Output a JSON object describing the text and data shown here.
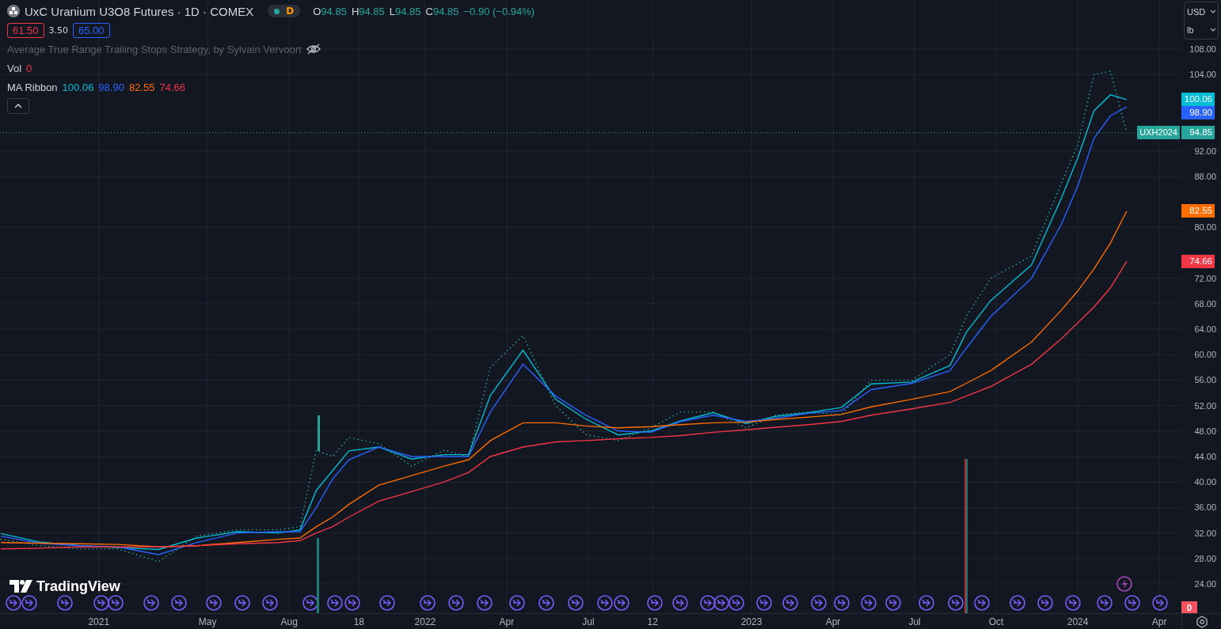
{
  "header": {
    "symbol_title": "UxC Uranium U3O8 Futures · 1D · COMEX",
    "market_status": {
      "open": true,
      "letter": "D"
    },
    "ohlc": [
      {
        "label": "O",
        "value": "94.85"
      },
      {
        "label": "H",
        "value": "94.85"
      },
      {
        "label": "L",
        "value": "94.85"
      },
      {
        "label": "C",
        "value": "94.85"
      }
    ],
    "change": "−0.90 (−0.94%)"
  },
  "strategy": {
    "inputs": [
      {
        "text": "61.50",
        "kind": "box",
        "color": "#f23645"
      },
      {
        "text": "3.50",
        "kind": "plain"
      },
      {
        "text": "65.00",
        "kind": "box",
        "color": "#2962ff"
      }
    ],
    "name": "Average True Range Trailing Stops Strategy, by Sylvain Vervoort",
    "hidden": true
  },
  "volume": {
    "label": "Vol",
    "value": "0"
  },
  "ma_ribbon": {
    "label": "MA Ribbon",
    "values": [
      {
        "text": "100.06",
        "color": "#00bcd4"
      },
      {
        "text": "98.90",
        "color": "#2962ff"
      },
      {
        "text": "82.55",
        "color": "#ff6d00"
      },
      {
        "text": "74.66",
        "color": "#f23645"
      }
    ]
  },
  "legend_toggle": {
    "expanded": true
  },
  "price_scale": {
    "currency": "USD",
    "unit": "lb",
    "last_labels": [
      {
        "text": "100.06"
      },
      {
        "text": "98.90"
      },
      {
        "text": "94.85"
      },
      {
        "text": "82.55"
      },
      {
        "text": "74.66"
      }
    ],
    "volume_label": {
      "text": "0",
      "color": "#f7525f"
    }
  },
  "branding": "TradingView",
  "chart_data": {
    "type": "line",
    "x": [
      "2020-09-13",
      "2020-10-25",
      "2020-12-10",
      "2021-01-22",
      "2021-03-07",
      "2021-04-19",
      "2021-06-04",
      "2021-07-19",
      "2021-08-13",
      "2021-09-01",
      "2021-09-19",
      "2021-10-07",
      "2021-11-10",
      "2021-12-16",
      "2022-01-22",
      "2022-02-19",
      "2022-03-13",
      "2022-04-19",
      "2022-05-25",
      "2022-06-28",
      "2022-08-04",
      "2022-09-10",
      "2022-10-13",
      "2022-11-19",
      "2022-12-25",
      "2023-01-28",
      "2023-03-04",
      "2023-04-10",
      "2023-05-13",
      "2023-06-28",
      "2023-08-10",
      "2023-08-28",
      "2023-09-25",
      "2023-11-10",
      "2023-12-13",
      "2024-01-01",
      "2024-01-19",
      "2024-02-07",
      "2024-02-25"
    ],
    "xlim": [
      "2020-09-12",
      "2024-06-09"
    ],
    "ylim": [
      19.4,
      115.7
    ],
    "grid": true,
    "ref_lines": [
      {
        "axis": "y",
        "value": 94.85,
        "color": "#26a69a"
      }
    ],
    "xticks": [
      {
        "value": "2021-01-01",
        "label": "2021"
      },
      {
        "value": "2021-05-01",
        "label": "May"
      },
      {
        "value": "2021-08-01",
        "label": "Aug"
      },
      {
        "value": "2021-10-18",
        "label": "18"
      },
      {
        "value": "2022-01-01",
        "label": "2022"
      },
      {
        "value": "2022-04-01",
        "label": "Apr"
      },
      {
        "value": "2022-07-01",
        "label": "Jul"
      },
      {
        "value": "2022-09-12",
        "label": "12"
      },
      {
        "value": "2023-01-01",
        "label": "2023"
      },
      {
        "value": "2023-04-01",
        "label": "Apr"
      },
      {
        "value": "2023-07-01",
        "label": "Jul"
      },
      {
        "value": "2023-10-01",
        "label": "Oct"
      },
      {
        "value": "2024-01-01",
        "label": "2024"
      },
      {
        "value": "2024-04-01",
        "label": "Apr"
      }
    ],
    "yticks": [
      {
        "value": 24,
        "label": "24.00"
      },
      {
        "value": 28,
        "label": "28.00"
      },
      {
        "value": 32,
        "label": "32.00"
      },
      {
        "value": 36,
        "label": "36.00"
      },
      {
        "value": 40,
        "label": "40.00"
      },
      {
        "value": 44,
        "label": "44.00"
      },
      {
        "value": 48,
        "label": "48.00"
      },
      {
        "value": 52,
        "label": "52.00"
      },
      {
        "value": 56,
        "label": "56.00"
      },
      {
        "value": 60,
        "label": "60.00"
      },
      {
        "value": 64,
        "label": "64.00"
      },
      {
        "value": 68,
        "label": "68.00"
      },
      {
        "value": 72,
        "label": "72.00"
      },
      {
        "value": 80,
        "label": "80.00"
      },
      {
        "value": 88,
        "label": "88.00"
      },
      {
        "value": 92,
        "label": "92.00"
      },
      {
        "value": 104,
        "label": "104.00"
      },
      {
        "value": 108,
        "label": "108.00"
      }
    ],
    "series": [
      {
        "color": "#00bcd4",
        "values": [
          31.9,
          30.6,
          30,
          29.7,
          29.4,
          31.2,
          32.2,
          32,
          32.5,
          38.7,
          41.8,
          44.9,
          45.5,
          43.6,
          44.3,
          44.3,
          53.6,
          60.7,
          53,
          49.9,
          47.4,
          48,
          49.6,
          50.9,
          49.2,
          50.3,
          50.9,
          51.7,
          55.4,
          55.7,
          58.3,
          63.5,
          68.5,
          74.1,
          84.6,
          90.9,
          98.3,
          100.8,
          100.06
        ]
      },
      {
        "color": "#2962ff",
        "values": [
          31.5,
          30.4,
          30,
          29.8,
          28.6,
          30.5,
          32,
          32.2,
          32.2,
          36,
          40.5,
          43.5,
          45.5,
          44,
          44,
          44,
          51,
          58.5,
          53.5,
          50.5,
          48,
          47.8,
          49.5,
          50.5,
          49.5,
          50,
          50.8,
          51.2,
          54.5,
          55.5,
          57.5,
          61,
          66,
          72,
          80.5,
          86.5,
          94,
          97.5,
          98.9
        ]
      },
      {
        "name": "UXH2024",
        "color": "#26a69a",
        "line_style": "dotted",
        "values": [
          31,
          30,
          29.5,
          29.5,
          27.5,
          31.5,
          32.5,
          32.5,
          33,
          45,
          44,
          47,
          46,
          42.5,
          45,
          44,
          58,
          63,
          52,
          47.5,
          46.5,
          48.5,
          51,
          51,
          48.5,
          50.5,
          51,
          50.5,
          56,
          56,
          60,
          66,
          72,
          75.5,
          87,
          93,
          104,
          104.5,
          94.85
        ]
      },
      {
        "color": "#ff6d00",
        "values": [
          30.5,
          30.4,
          30.3,
          30.2,
          29.8,
          30,
          30.5,
          31,
          31.2,
          33,
          34.5,
          36.5,
          39.5,
          41,
          42.5,
          43.5,
          46.5,
          49.3,
          49.3,
          48.8,
          48.5,
          48.7,
          49,
          49.3,
          49.4,
          49.8,
          50.2,
          50.6,
          51.8,
          53,
          54.2,
          55.5,
          57.5,
          62,
          67,
          70,
          73.5,
          77.5,
          82.55
        ]
      },
      {
        "color": "#f23645",
        "values": [
          29.5,
          29.6,
          29.8,
          29.8,
          29.8,
          30,
          30.3,
          30.5,
          30.8,
          32,
          33,
          34.5,
          37,
          38.5,
          40,
          41.5,
          44,
          45.5,
          46.3,
          46.5,
          46.8,
          47,
          47.3,
          47.8,
          48.2,
          48.6,
          49,
          49.5,
          50.5,
          51.5,
          52.5,
          53.5,
          55,
          58.5,
          62.5,
          65,
          67.5,
          70.5,
          74.66
        ]
      }
    ]
  }
}
